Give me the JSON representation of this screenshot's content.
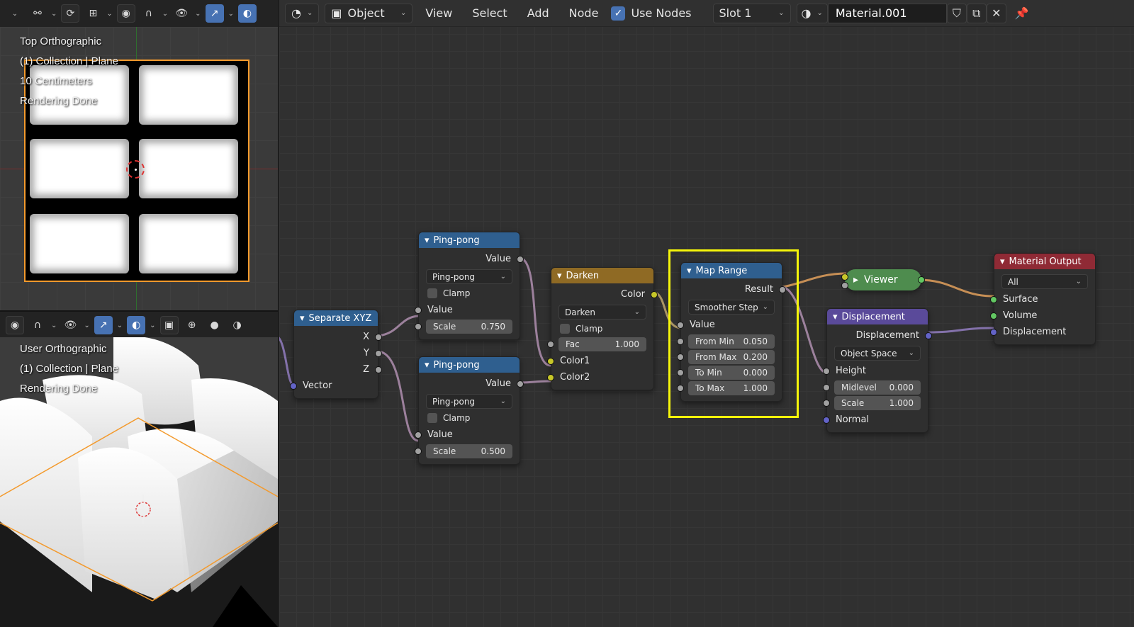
{
  "left": {
    "top_viewport": {
      "lines": [
        "Top Orthographic",
        "(1) Collection | Plane",
        "10 Centimeters",
        "Rendering Done"
      ]
    },
    "bottom_viewport": {
      "lines": [
        "User Orthographic",
        "(1) Collection | Plane",
        "Rendering Done"
      ]
    }
  },
  "header": {
    "mode": "Object",
    "menus": [
      "View",
      "Select",
      "Add",
      "Node"
    ],
    "use_nodes_label": "Use Nodes",
    "use_nodes_checked": true,
    "slot": "Slot 1",
    "material": "Material.001"
  },
  "nodes": {
    "separate_xyz": {
      "title": "Separate XYZ",
      "outputs": [
        "X",
        "Y",
        "Z"
      ],
      "input": "Vector"
    },
    "pingpong1": {
      "title": "Ping-pong",
      "output": "Value",
      "mode": "Ping-pong",
      "clamp": "Clamp",
      "value": "Value",
      "scale_label": "Scale",
      "scale": "0.750"
    },
    "pingpong2": {
      "title": "Ping-pong",
      "output": "Value",
      "mode": "Ping-pong",
      "clamp": "Clamp",
      "value": "Value",
      "scale_label": "Scale",
      "scale": "0.500"
    },
    "darken": {
      "title": "Darken",
      "output": "Color",
      "mode": "Darken",
      "clamp": "Clamp",
      "fac_label": "Fac",
      "fac": "1.000",
      "color1": "Color1",
      "color2": "Color2"
    },
    "map_range": {
      "title": "Map Range",
      "output": "Result",
      "interp": "Smoother Step",
      "value": "Value",
      "fields": [
        {
          "label": "From Min",
          "value": "0.050"
        },
        {
          "label": "From Max",
          "value": "0.200"
        },
        {
          "label": "To Min",
          "value": "0.000"
        },
        {
          "label": "To Max",
          "value": "1.000"
        }
      ]
    },
    "viewer": {
      "title": "Viewer"
    },
    "displacement": {
      "title": "Displacement",
      "output": "Displacement",
      "space": "Object Space",
      "height": "Height",
      "midlevel_label": "Midlevel",
      "midlevel": "0.000",
      "scale_label": "Scale",
      "scale": "1.000",
      "normal": "Normal"
    },
    "material_output": {
      "title": "Material Output",
      "target": "All",
      "inputs": [
        "Surface",
        "Volume",
        "Displacement"
      ]
    }
  }
}
